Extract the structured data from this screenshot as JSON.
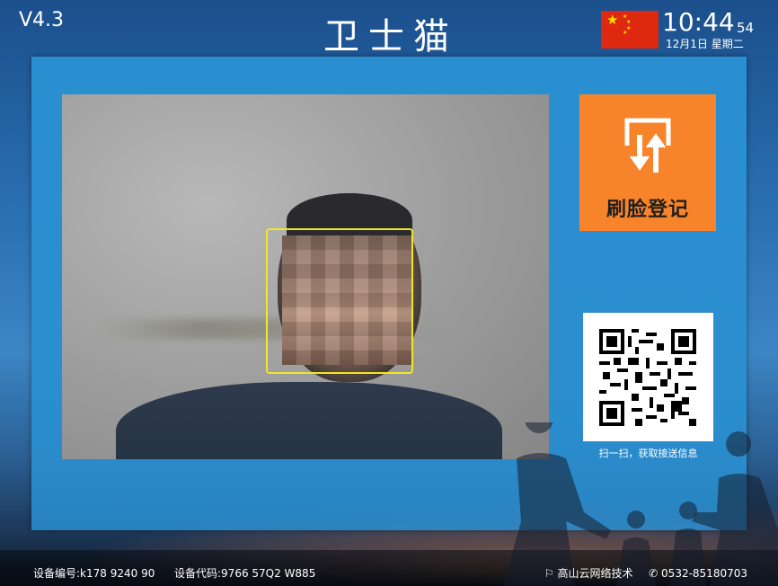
{
  "header": {
    "version": "V4.3",
    "app_title": "卫士猫",
    "flag": "china-flag",
    "time": "10:44",
    "seconds": "54",
    "date": "12月1日  星期二"
  },
  "main": {
    "register_button_label": "刷脸登记",
    "register_icon": "face-register-icon",
    "qr_caption": "扫一扫，获取接送信息"
  },
  "footer": {
    "device_number": "设备编号:k178  9240  90",
    "device_code": "设备代码:9766  57Q2  W885",
    "company": "高山云网络技术",
    "phone": "0532-85180703"
  },
  "colors": {
    "register_button": "#f7842a",
    "face_box": "#f2e629",
    "panel": "#2a8fd0"
  }
}
